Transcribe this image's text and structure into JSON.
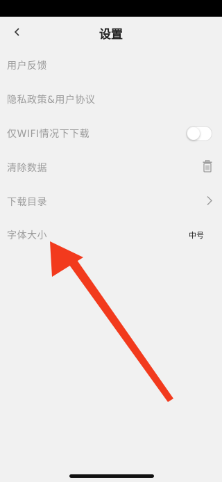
{
  "header": {
    "title": "设置"
  },
  "settings": {
    "items": [
      {
        "label": "用户反馈"
      },
      {
        "label": "隐私政策&用户协议"
      },
      {
        "label": "仅WIFI情况下下载"
      },
      {
        "label": "清除数据"
      },
      {
        "label": "下载目录"
      },
      {
        "label": "字体大小",
        "value": "中号"
      }
    ],
    "wifi_only_enabled": false
  },
  "icons": {
    "back": "back-chevron-icon",
    "clear": "trash-icon",
    "directory": "chevron-right-icon"
  },
  "colors": {
    "background": "#f1f1f1",
    "annotation_arrow": "#f23a1d"
  }
}
